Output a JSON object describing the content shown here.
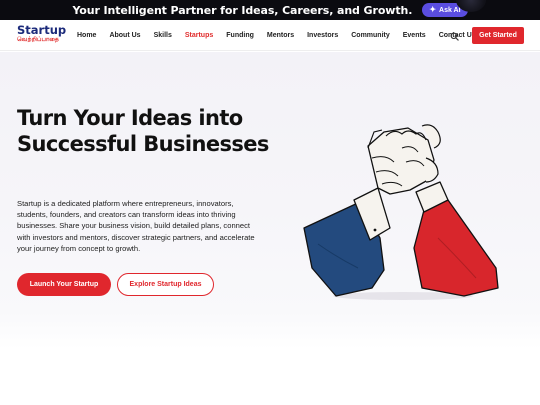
{
  "topbar": {
    "tagline": "Your Intelligent Partner for Ideas, Careers, and Growth.",
    "ask_ai_label": "Ask AI"
  },
  "brand": {
    "name": "Startup",
    "subtitle": "வெற்றிப்பாதை"
  },
  "nav": {
    "items": [
      {
        "label": "Home",
        "active": false
      },
      {
        "label": "About Us",
        "active": false
      },
      {
        "label": "Skills",
        "active": false
      },
      {
        "label": "Startups",
        "active": true
      },
      {
        "label": "Funding",
        "active": false
      },
      {
        "label": "Mentors",
        "active": false
      },
      {
        "label": "Investors",
        "active": false
      },
      {
        "label": "Community",
        "active": false
      },
      {
        "label": "Events",
        "active": false
      },
      {
        "label": "Contact Us",
        "active": false
      }
    ],
    "cta_label": "Get Started"
  },
  "hero": {
    "title": "Turn Your Ideas into Successful Businesses",
    "description": "Startup is a dedicated platform where entrepreneurs, innovators, students, founders, and creators can transform ideas into thriving businesses. Share your business vision, build detailed plans, connect with investors and mentors, discover strategic partners, and accelerate your journey from concept to growth.",
    "primary_button": "Launch Your Startup",
    "secondary_button": "Explore Startup Ideas"
  },
  "colors": {
    "accent_red": "#e0272d",
    "brand_blue": "#1b2a7a",
    "ask_ai_purple": "#5a4de0",
    "sleeve_blue": "#234a7e"
  },
  "icons": {
    "ask_ai": "sparkle-icon",
    "search": "search-icon",
    "illustration": "handshake-arm-wrestle-illustration"
  }
}
